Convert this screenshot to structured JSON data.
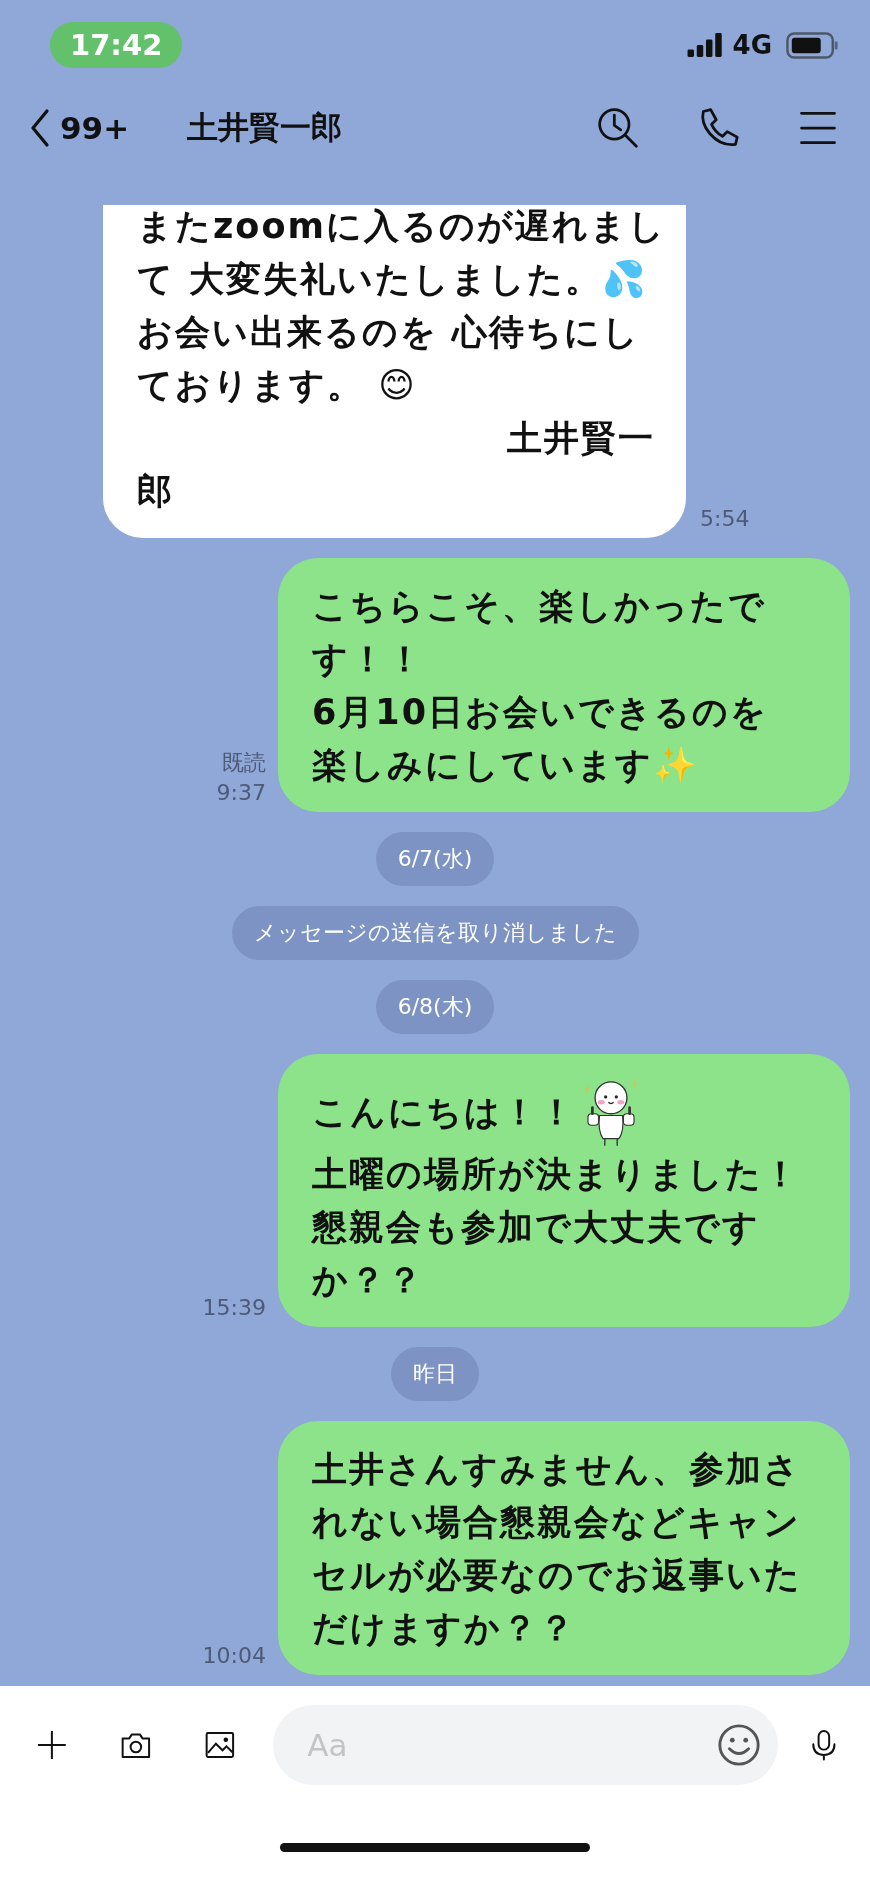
{
  "status_bar": {
    "time": "17:42",
    "network": "4G"
  },
  "header": {
    "unread_count": "99+",
    "title": "土井賢一郎"
  },
  "messages": [
    {
      "kind": "incoming",
      "paragraphs": [
        {
          "text": "またzoomに入るのが遅れまして 大変失礼いたしました。💦\nお会い出来るのを 心待ちにしております。 😊\n　　　　　　　　　　土井賢一郎"
        }
      ],
      "time": "5:54"
    },
    {
      "kind": "outgoing",
      "paragraphs": [
        {
          "text": "こちらこそ、楽しかったです！！\n6月10日お会いできるのを楽しみにしています✨"
        }
      ],
      "read": "既読",
      "time": "9:37"
    },
    {
      "kind": "date",
      "text": "6/7(水)"
    },
    {
      "kind": "system",
      "text": "メッセージの送信を取り消しました"
    },
    {
      "kind": "date",
      "text": "6/8(木)"
    },
    {
      "kind": "outgoing",
      "paragraphs": [
        {
          "text": "こんにちは！！",
          "sticker": true
        },
        {
          "text": "土曜の場所が決まりました！懇親会も参加で大丈夫ですか？？"
        }
      ],
      "time": "15:39"
    },
    {
      "kind": "date",
      "text": "昨日"
    },
    {
      "kind": "outgoing",
      "paragraphs": [
        {
          "text": "土井さんすみません、参加されない場合懇親会などキャンセルが必要なのでお返事いただけますか？？"
        }
      ],
      "time": "10:04"
    }
  ],
  "composer": {
    "placeholder": "Aa"
  }
}
